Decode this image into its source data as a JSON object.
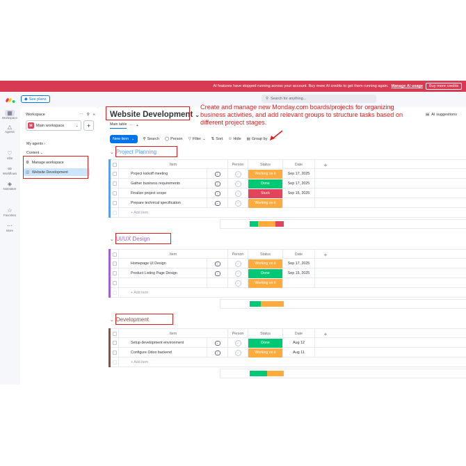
{
  "banner": {
    "message": "AI features have stopped running across your account. Buy more AI credits to get them running again.",
    "manage_link": "Manage AI usage",
    "buy_button": "Buy more credits"
  },
  "topbar": {
    "see_plans": "See plans",
    "search_placeholder": "Search for anything..."
  },
  "rail": {
    "items": [
      {
        "label": "Workspace",
        "icon": "grid-icon"
      },
      {
        "label": "Agents",
        "icon": "agents-icon"
      },
      {
        "label": "Vibe",
        "icon": "heart-icon"
      },
      {
        "label": "Workflows",
        "icon": "workflows-icon"
      },
      {
        "label": "Notetaker",
        "icon": "diamond-icon"
      },
      {
        "label": "Favorites",
        "icon": "star-icon"
      },
      {
        "label": "More",
        "icon": "more-icon"
      }
    ]
  },
  "sidebar": {
    "workspace_label": "Workspace",
    "workspace_name": "Main workspace",
    "workspace_badge": "M",
    "my_agents": "My agents",
    "content": "Content",
    "items": [
      {
        "label": "Manage workspace"
      },
      {
        "label": "Website Development"
      }
    ]
  },
  "board": {
    "title": "Website Development",
    "annotation": "Create and manage new Monday.com boards/projects for organizing business activities, and add relevant groups to structure tasks based on different project stages.",
    "ai_suggestions": "AI suggestions",
    "tab_main": "Main table",
    "toolbar": {
      "new_item": "New item",
      "search": "Search",
      "person": "Person",
      "filter": "Filter",
      "sort": "Sort",
      "hide": "Hide",
      "group_by": "Group by"
    },
    "columns": {
      "item": "Item",
      "person": "Person",
      "status": "Status",
      "date": "Date",
      "plus": "+"
    },
    "add_item": "+ Add item",
    "groups": [
      {
        "title": "Project Planning",
        "color": "#579bfc",
        "rows": [
          {
            "item": "Project kickoff meeting",
            "status": "Working on it",
            "status_color": "#fdab3d",
            "date": "Sep 17, 2025"
          },
          {
            "item": "Gather business requirements",
            "status": "Done",
            "status_color": "#00c875",
            "date": "Sep 17, 2025"
          },
          {
            "item": "Finalize project scope",
            "status": "Stuck",
            "status_color": "#e2445c",
            "date": "Sep 15, 2025"
          },
          {
            "item": "Prepare technical specification",
            "status": "Working on it",
            "status_color": "#fdab3d",
            "date": ""
          }
        ]
      },
      {
        "title": "UI/UX Design",
        "color": "#a25ddc",
        "rows": [
          {
            "item": "Homepage UI Design",
            "status": "Working on it",
            "status_color": "#fdab3d",
            "date": "Sep 17, 2025"
          },
          {
            "item": "Product Listing Page Design",
            "status": "Done",
            "status_color": "#00c875",
            "date": "Sep 15, 2025"
          },
          {
            "item": "",
            "status": "Working on it",
            "status_color": "#fdab3d",
            "date": ""
          }
        ]
      },
      {
        "title": "Development",
        "color": "#7f5347",
        "rows": [
          {
            "item": "Setup development environment",
            "status": "Done",
            "status_color": "#00c875",
            "date": "Aug 12"
          },
          {
            "item": "Configure Odoo backend",
            "status": "Working on it",
            "status_color": "#fdab3d",
            "date": "Aug 11"
          }
        ]
      }
    ]
  }
}
